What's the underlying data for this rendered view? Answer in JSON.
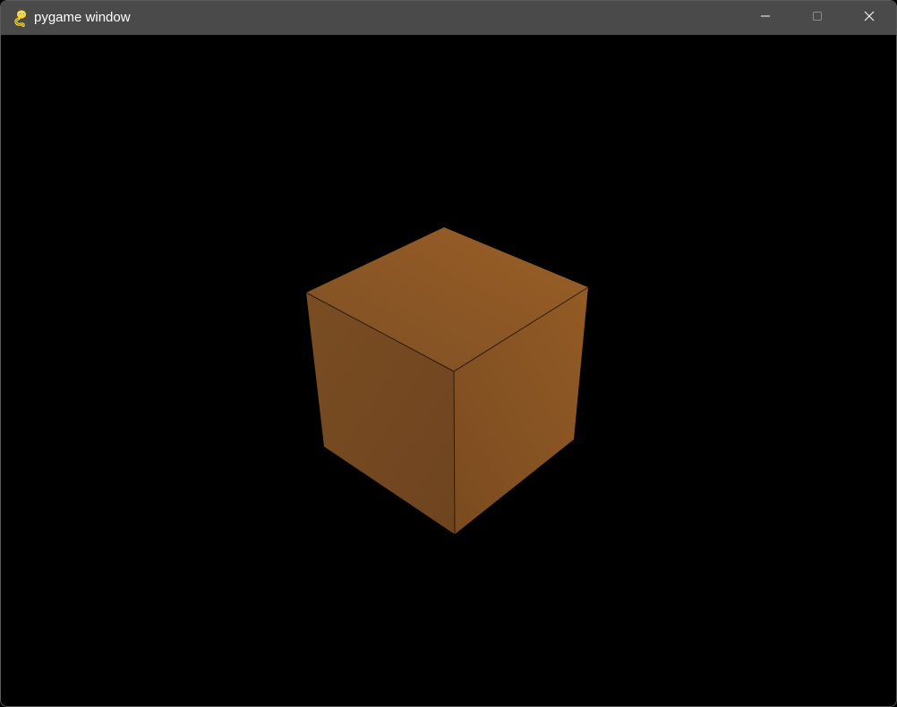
{
  "window": {
    "title": "pygame window"
  },
  "titlebar": {
    "app_icon": "pygame-snake-icon",
    "buttons": {
      "minimize_icon": "minimize-icon",
      "maximize_icon": "maximize-icon",
      "close_icon": "close-icon"
    }
  },
  "scene": {
    "object": "cube",
    "colors": {
      "background": "#000000",
      "top_face": "#8f5a26",
      "left_face": "#744a22",
      "right_face": "#8a5524",
      "edges": "#2a1a10"
    }
  }
}
